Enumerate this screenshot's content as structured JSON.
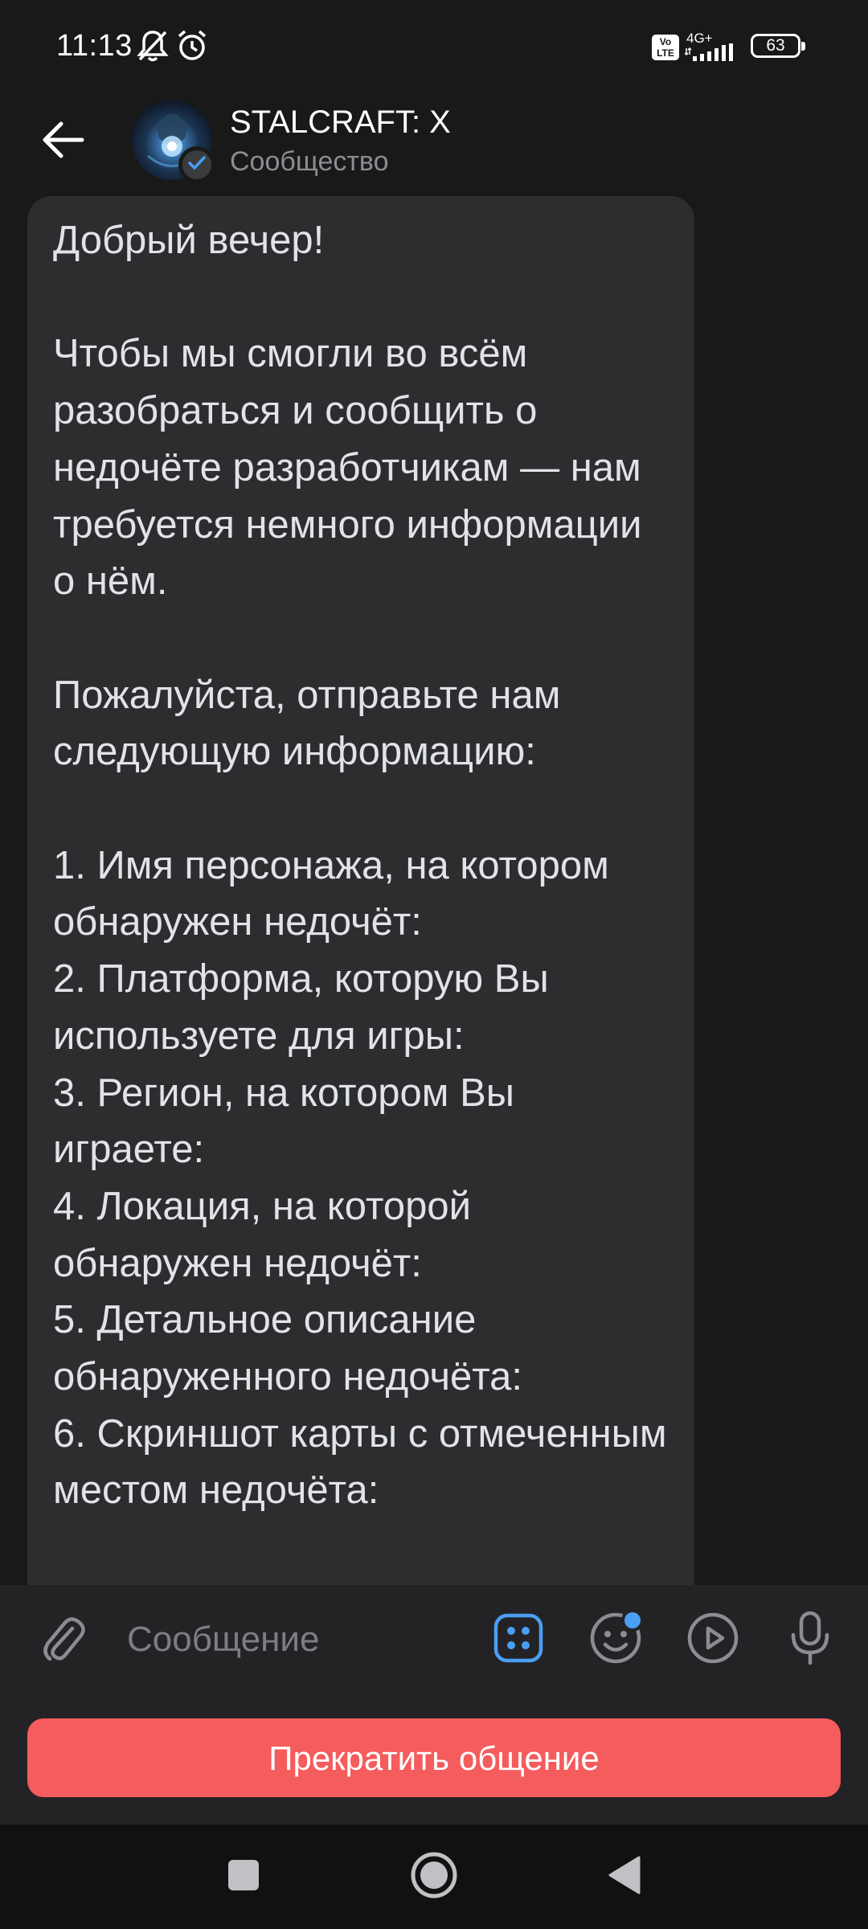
{
  "status_bar": {
    "time": "11:13",
    "battery": "63",
    "network_label": "4G+",
    "volte_label": "Vo LTE"
  },
  "header": {
    "title": "STALCRAFT: X",
    "subtitle": "Сообщество"
  },
  "message": {
    "text": "Добрый вечер!\n\nЧтобы мы смогли во всём разобраться и сообщить о недочёте разработчикам — нам требуется немного информации о нём.\n\nПожалуйста, отправьте нам следующую информацию:\n\n1. Имя персонажа, на котором обнаружен недочёт:\n2. Платформа, которую Вы используете для игры:\n3. Регион, на котором Вы играете:\n4. Локация, на которой обнаружен недочёт:\n5. Детальное описание обнаруженного недочёта:\n6. Скриншот карты с отмеченным местом недочёта:"
  },
  "composer": {
    "placeholder": "Сообщение"
  },
  "actions": {
    "stop_label": "Прекратить общение"
  },
  "colors": {
    "background": "#19191a",
    "bubble": "#2c2d2f",
    "composer": "#232325",
    "accent": "#4a9ff5",
    "stop_button": "#f45c5d"
  },
  "icons": {
    "status": [
      "mute-bell-icon",
      "alarm-icon",
      "volte-icon",
      "signal-icon",
      "battery-icon"
    ],
    "header": [
      "back-arrow-icon",
      "verified-check-icon"
    ],
    "composer": [
      "paperclip-icon",
      "apps-grid-icon",
      "emoji-icon",
      "play-icon",
      "microphone-icon"
    ],
    "nav": [
      "square-icon",
      "circle-icon",
      "triangle-back-icon"
    ]
  }
}
